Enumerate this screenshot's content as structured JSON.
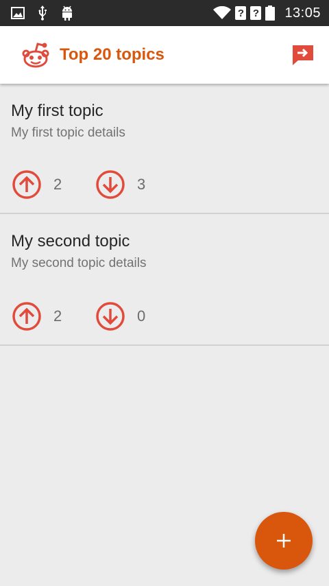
{
  "status_bar": {
    "time": "13:05",
    "left_icons": [
      "image-icon",
      "usb-icon",
      "android-icon"
    ],
    "right_icons": [
      "wifi-icon",
      "sim-unknown-icon",
      "sim-unknown-icon",
      "battery-icon"
    ],
    "sim_glyph": "?"
  },
  "app_bar": {
    "title": "Top 20 topics",
    "logo_icon": "reddit-alien-icon",
    "action_icon": "share-exit-icon"
  },
  "topics": [
    {
      "title": "My first topic",
      "details": "My first topic details",
      "upvotes": "2",
      "downvotes": "3"
    },
    {
      "title": "My second topic",
      "details": "My second topic details",
      "upvotes": "2",
      "downvotes": "0"
    }
  ],
  "fab": {
    "icon": "plus-icon"
  },
  "colors": {
    "accent": "#d9560d",
    "vote_red": "#e04b3c",
    "background": "#ececec",
    "status_bar": "#2b2b2b"
  }
}
